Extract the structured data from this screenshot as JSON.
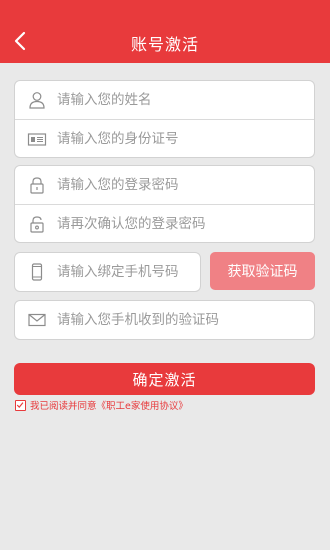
{
  "header": {
    "title": "账号激活"
  },
  "icons": {
    "back": "chevron-left-icon",
    "name": "user-icon",
    "id_card": "id-card-icon",
    "password": "lock-icon",
    "confirm_password": "unlock-icon",
    "phone": "mobile-phone-icon",
    "code": "envelope-icon",
    "agree": "checkbox-checked-icon"
  },
  "form": {
    "name_placeholder": "请输入您的姓名",
    "id_placeholder": "请输入您的身份证号",
    "password_placeholder": "请输入您的登录密码",
    "confirm_password_placeholder": "请再次确认您的登录密码",
    "phone_placeholder": "请输入绑定手机号码",
    "code_placeholder": "请输入您手机收到的验证码"
  },
  "buttons": {
    "get_code": "获取验证码",
    "confirm": "确定激活"
  },
  "agreement": {
    "prefix": "我已阅读并同意",
    "link": "《职工e家使用协议》"
  },
  "colors": {
    "primary": "#e83a3c",
    "code_button": "#f08185",
    "background": "#e9e9e9"
  }
}
